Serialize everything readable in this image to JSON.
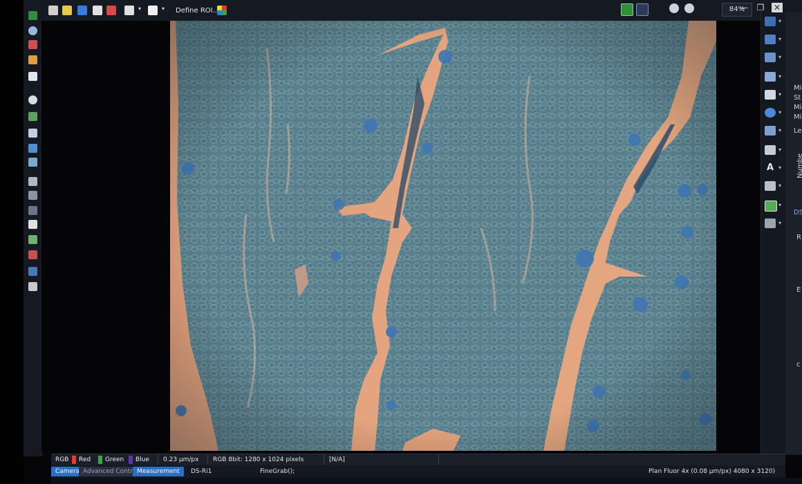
{
  "toolbar": {
    "roi_label": "Define ROI...",
    "zoom": "84%"
  },
  "status": {
    "channels": [
      {
        "label": "RGB",
        "color": "#d9d9d9"
      },
      {
        "label": "Red",
        "color": "#e53935"
      },
      {
        "label": "Green",
        "color": "#43a047"
      },
      {
        "label": "Blue",
        "color": "#5e35b1"
      }
    ],
    "pixel_size": "0.23 µm/px",
    "image_info": "RGB 8bit: 1280 x 1024 pixels",
    "value": "[N/A]"
  },
  "tabs": {
    "camera_settings": "Camera Settings",
    "advanced_controls": "Advanced Controls",
    "measurement": "Measurement",
    "camera": "DS-Ri1",
    "command": "FineGrab();",
    "objective": "Plan Fluor 4x (0.08 µm/px) 4080 x 3120)"
  },
  "side_panel": {
    "labels": [
      "Mi",
      "St",
      "Mi",
      "Mi",
      "Le",
      "Numbe",
      "DS-",
      "R",
      "E",
      "c"
    ]
  },
  "colors": {
    "tissue": "#567d8c",
    "lumen": "#e3a27e",
    "accent_green": "#2f8f3a"
  },
  "icons": [
    "select-icon",
    "zoom-icon",
    "roi-icon",
    "measure-icon",
    "grid-icon",
    "text-icon",
    "fit-icon",
    "minimize-icon",
    "restore-icon",
    "close-icon"
  ]
}
